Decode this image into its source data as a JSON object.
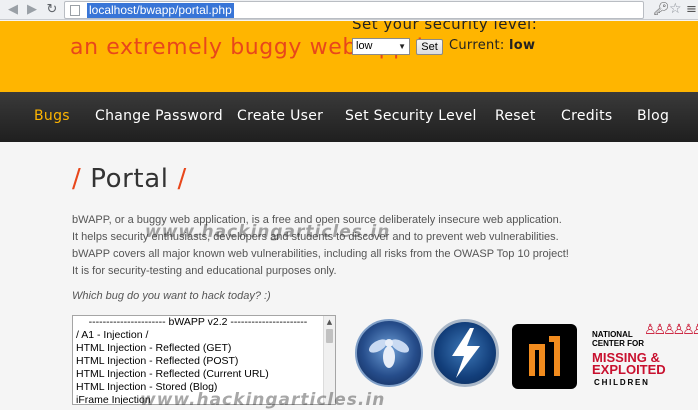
{
  "browser": {
    "url": "localhost/bwapp/portal.php",
    "icons": [
      "back-icon",
      "forward-icon",
      "reload-icon",
      "page-icon",
      "key-icon",
      "star-icon",
      "menu-icon"
    ]
  },
  "header": {
    "tagline": "an extremely buggy web app !",
    "security_label": "Set your security level:",
    "security_value": "low",
    "set_button": "Set",
    "current_label": "Current:",
    "current_value": "low"
  },
  "menu": {
    "items": [
      {
        "label": "Bugs",
        "active": true
      },
      {
        "label": "Change Password"
      },
      {
        "label": "Create User"
      },
      {
        "label": "Set Security Level"
      },
      {
        "label": "Reset"
      },
      {
        "label": "Credits"
      },
      {
        "label": "Blog"
      }
    ]
  },
  "main": {
    "title": "Portal",
    "intro": [
      "bWAPP, or a buggy web application, is a free and open source deliberately insecure web application.",
      "It helps security enthusiasts, developers and students to discover and to prevent web vulnerabilities.",
      "bWAPP covers all major known web vulnerabilities, including all risks from the OWASP Top 10 project!",
      "It is for security-testing and educational purposes only."
    ],
    "question": "Which bug do you want to hack today? :)",
    "watermark": "www.hackingarticles.in",
    "bug_list": [
      "---------------------- bWAPP v2.2 ----------------------",
      "/ A1 - Injection /",
      "HTML Injection - Reflected (GET)",
      "HTML Injection - Reflected (POST)",
      "HTML Injection - Reflected (Current URL)",
      "HTML Injection - Stored (Blog)",
      "iFrame Injection"
    ]
  },
  "logos": {
    "ncmec_line1": "NATIONAL",
    "ncmec_line2": "CENTER FOR",
    "ncmec_line3": "MISSING &",
    "ncmec_line4": "EXPLOITED",
    "ncmec_line5": "CHILDREN"
  },
  "colors": {
    "header_bg": "#ffb500",
    "accent_orange": "#e8471b",
    "menu_bg": "#2a2a2a",
    "menu_active": "#ffb500"
  }
}
